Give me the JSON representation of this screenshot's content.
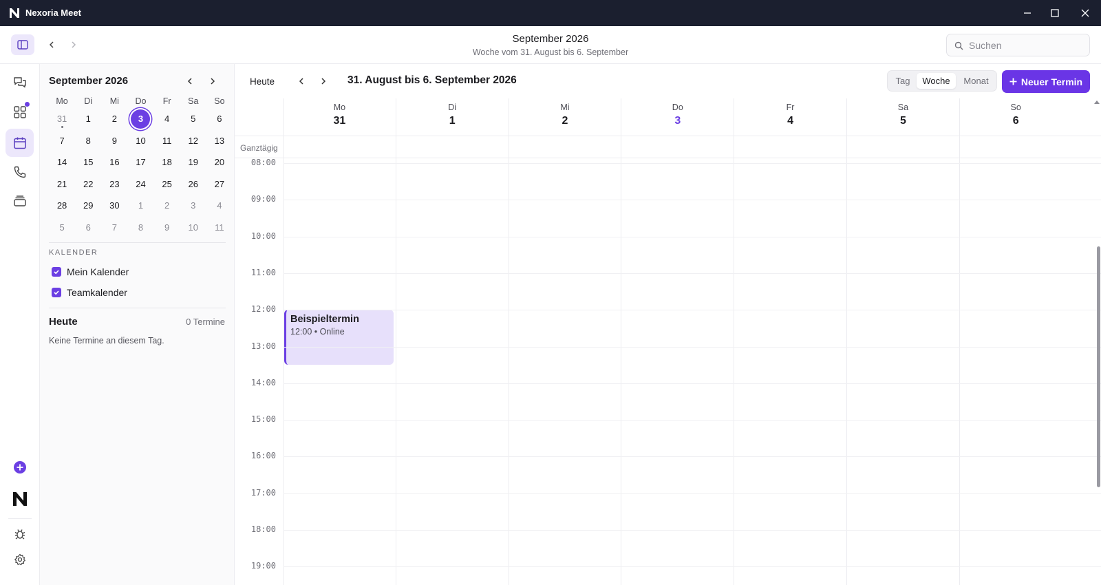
{
  "window": {
    "title": "Nexoria Meet"
  },
  "header": {
    "title": "September 2026",
    "subtitle": "Woche vom 31. August bis 6. September",
    "search_placeholder": "Suchen"
  },
  "mini_calendar": {
    "title": "September 2026",
    "weekdays": [
      "Mo",
      "Di",
      "Mi",
      "Do",
      "Fr",
      "Sa",
      "So"
    ],
    "weeks": [
      [
        {
          "d": "31",
          "o": true,
          "dot": true
        },
        {
          "d": "1"
        },
        {
          "d": "2"
        },
        {
          "d": "3",
          "today": true
        },
        {
          "d": "4"
        },
        {
          "d": "5"
        },
        {
          "d": "6"
        }
      ],
      [
        {
          "d": "7"
        },
        {
          "d": "8"
        },
        {
          "d": "9"
        },
        {
          "d": "10"
        },
        {
          "d": "11"
        },
        {
          "d": "12"
        },
        {
          "d": "13"
        }
      ],
      [
        {
          "d": "14"
        },
        {
          "d": "15"
        },
        {
          "d": "16"
        },
        {
          "d": "17"
        },
        {
          "d": "18"
        },
        {
          "d": "19"
        },
        {
          "d": "20"
        }
      ],
      [
        {
          "d": "21"
        },
        {
          "d": "22"
        },
        {
          "d": "23"
        },
        {
          "d": "24"
        },
        {
          "d": "25"
        },
        {
          "d": "26"
        },
        {
          "d": "27"
        }
      ],
      [
        {
          "d": "28"
        },
        {
          "d": "29"
        },
        {
          "d": "30"
        },
        {
          "d": "1",
          "o": true
        },
        {
          "d": "2",
          "o": true
        },
        {
          "d": "3",
          "o": true
        },
        {
          "d": "4",
          "o": true
        }
      ],
      [
        {
          "d": "5",
          "o": true
        },
        {
          "d": "6",
          "o": true
        },
        {
          "d": "7",
          "o": true
        },
        {
          "d": "8",
          "o": true
        },
        {
          "d": "9",
          "o": true
        },
        {
          "d": "10",
          "o": true
        },
        {
          "d": "11",
          "o": true
        }
      ]
    ]
  },
  "calendars": {
    "label": "KALENDER",
    "items": [
      {
        "label": "Mein Kalender",
        "checked": true
      },
      {
        "label": "Teamkalender",
        "checked": true
      }
    ]
  },
  "today_panel": {
    "title": "Heute",
    "count": "0 Termine",
    "empty": "Keine Termine an diesem Tag."
  },
  "toolbar": {
    "today_label": "Heute",
    "range": "31. August bis 6. September 2026",
    "views": [
      "Tag",
      "Woche",
      "Monat"
    ],
    "active_view": "Woche",
    "new_button": "Neuer Termin"
  },
  "week": {
    "days": [
      {
        "name": "Mo",
        "num": "31"
      },
      {
        "name": "Di",
        "num": "1"
      },
      {
        "name": "Mi",
        "num": "2"
      },
      {
        "name": "Do",
        "num": "3",
        "today": true
      },
      {
        "name": "Fr",
        "num": "4"
      },
      {
        "name": "Sa",
        "num": "5"
      },
      {
        "name": "So",
        "num": "6"
      }
    ],
    "allday_label": "Ganztägig",
    "hours": [
      "08:00",
      "09:00",
      "10:00",
      "11:00",
      "12:00",
      "13:00",
      "14:00",
      "15:00",
      "16:00",
      "17:00",
      "18:00",
      "19:00"
    ]
  },
  "events": [
    {
      "title": "Beispieltermin",
      "meta": "12:00 • Online",
      "day": "Mo",
      "start": "12:00",
      "end": "13:30"
    }
  ],
  "colors": {
    "accent": "#6b3fe3",
    "titlebar": "#1b1f2f",
    "event_bg": "#e7e0fb"
  }
}
